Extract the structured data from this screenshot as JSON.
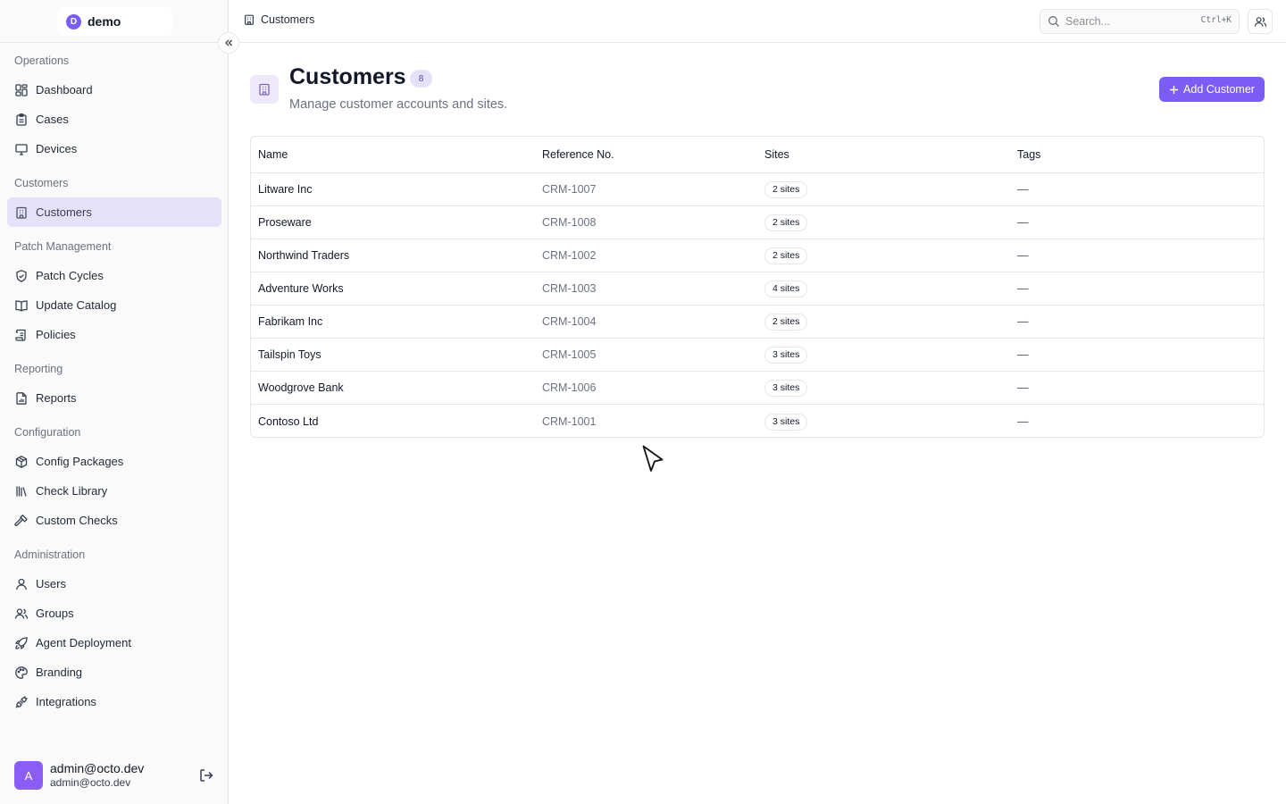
{
  "brand": {
    "logo_letter": "D",
    "name": "demo"
  },
  "sidebar": {
    "groups": [
      {
        "label": "Operations",
        "items": [
          {
            "label": "Dashboard",
            "icon": "dashboard-icon"
          },
          {
            "label": "Cases",
            "icon": "clipboard-icon"
          },
          {
            "label": "Devices",
            "icon": "monitor-icon"
          }
        ]
      },
      {
        "label": "Customers",
        "items": [
          {
            "label": "Customers",
            "icon": "building-icon",
            "active": true
          }
        ]
      },
      {
        "label": "Patch Management",
        "items": [
          {
            "label": "Patch Cycles",
            "icon": "shield-check-icon"
          },
          {
            "label": "Update Catalog",
            "icon": "book-open-icon"
          },
          {
            "label": "Policies",
            "icon": "scroll-icon"
          }
        ]
      },
      {
        "label": "Reporting",
        "items": [
          {
            "label": "Reports",
            "icon": "file-chart-icon"
          }
        ]
      },
      {
        "label": "Configuration",
        "items": [
          {
            "label": "Config Packages",
            "icon": "package-icon"
          },
          {
            "label": "Check Library",
            "icon": "library-icon"
          },
          {
            "label": "Custom Checks",
            "icon": "hammer-icon"
          }
        ]
      },
      {
        "label": "Administration",
        "items": [
          {
            "label": "Users",
            "icon": "user-icon"
          },
          {
            "label": "Groups",
            "icon": "users-icon"
          },
          {
            "label": "Agent Deployment",
            "icon": "rocket-icon"
          },
          {
            "label": "Branding",
            "icon": "palette-icon"
          },
          {
            "label": "Integrations",
            "icon": "plug-icon"
          }
        ]
      }
    ]
  },
  "user": {
    "avatar_letter": "A",
    "name": "admin@octo.dev",
    "email": "admin@octo.dev"
  },
  "topbar": {
    "breadcrumb": "Customers",
    "search_placeholder": "Search...",
    "search_shortcut": "Ctrl+K"
  },
  "page": {
    "title": "Customers",
    "count": "8",
    "subtitle": "Manage customer accounts and sites.",
    "add_button": "Add Customer"
  },
  "table": {
    "columns": [
      "Name",
      "Reference No.",
      "Sites",
      "Tags"
    ],
    "rows": [
      {
        "name": "Litware Inc",
        "ref": "CRM-1007",
        "sites": "2 sites",
        "tags": "—"
      },
      {
        "name": "Proseware",
        "ref": "CRM-1008",
        "sites": "2 sites",
        "tags": "—"
      },
      {
        "name": "Northwind Traders",
        "ref": "CRM-1002",
        "sites": "2 sites",
        "tags": "—"
      },
      {
        "name": "Adventure Works",
        "ref": "CRM-1003",
        "sites": "4 sites",
        "tags": "—"
      },
      {
        "name": "Fabrikam Inc",
        "ref": "CRM-1004",
        "sites": "2 sites",
        "tags": "—"
      },
      {
        "name": "Tailspin Toys",
        "ref": "CRM-1005",
        "sites": "3 sites",
        "tags": "—"
      },
      {
        "name": "Woodgrove Bank",
        "ref": "CRM-1006",
        "sites": "3 sites",
        "tags": "—"
      },
      {
        "name": "Contoso Ltd",
        "ref": "CRM-1001",
        "sites": "3 sites",
        "tags": "—"
      }
    ]
  }
}
